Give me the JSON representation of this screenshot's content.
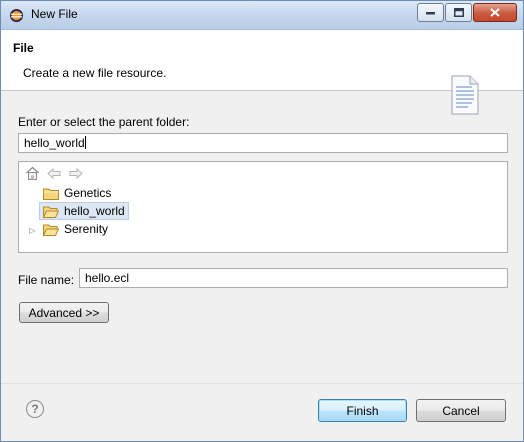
{
  "window": {
    "title": "New File"
  },
  "banner": {
    "title": "File",
    "description": "Create a new file resource."
  },
  "parent_folder": {
    "label": "Enter or select the parent folder:",
    "value": "hello_world"
  },
  "tree": {
    "items": [
      {
        "label": "Genetics",
        "selected": false,
        "expandable": false
      },
      {
        "label": "hello_world",
        "selected": true,
        "expandable": false
      },
      {
        "label": "Serenity",
        "selected": false,
        "expandable": true
      }
    ]
  },
  "file_name": {
    "label": "File name:",
    "value": "hello.ecl"
  },
  "buttons": {
    "advanced": "Advanced >>",
    "finish": "Finish",
    "cancel": "Cancel",
    "help": "?"
  },
  "colors": {
    "selection": "#dde7f3",
    "folder": "#e8c25b"
  }
}
